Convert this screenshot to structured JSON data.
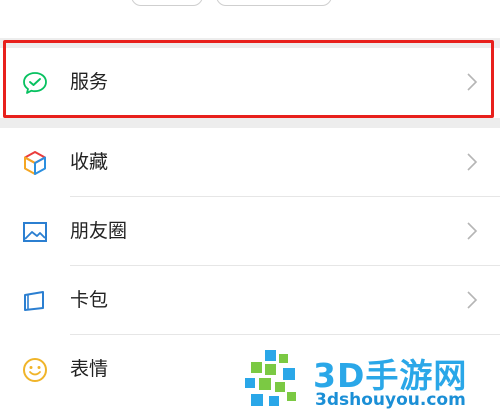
{
  "menu": {
    "services": {
      "label": "服务",
      "icon": "wechat-pay-icon"
    },
    "items": [
      {
        "label": "收藏",
        "icon": "favorites-cube-icon"
      },
      {
        "label": "朋友圈",
        "icon": "moments-picture-icon"
      },
      {
        "label": "卡包",
        "icon": "card-wallet-icon"
      },
      {
        "label": "表情",
        "icon": "sticker-smiley-icon"
      }
    ]
  },
  "watermark": {
    "title": "3D手游网",
    "url": "3dshouyou.com"
  },
  "colors": {
    "highlight_border": "#e8201c",
    "services_green": "#07c160",
    "watermark_blue": "#2aa7e8"
  }
}
